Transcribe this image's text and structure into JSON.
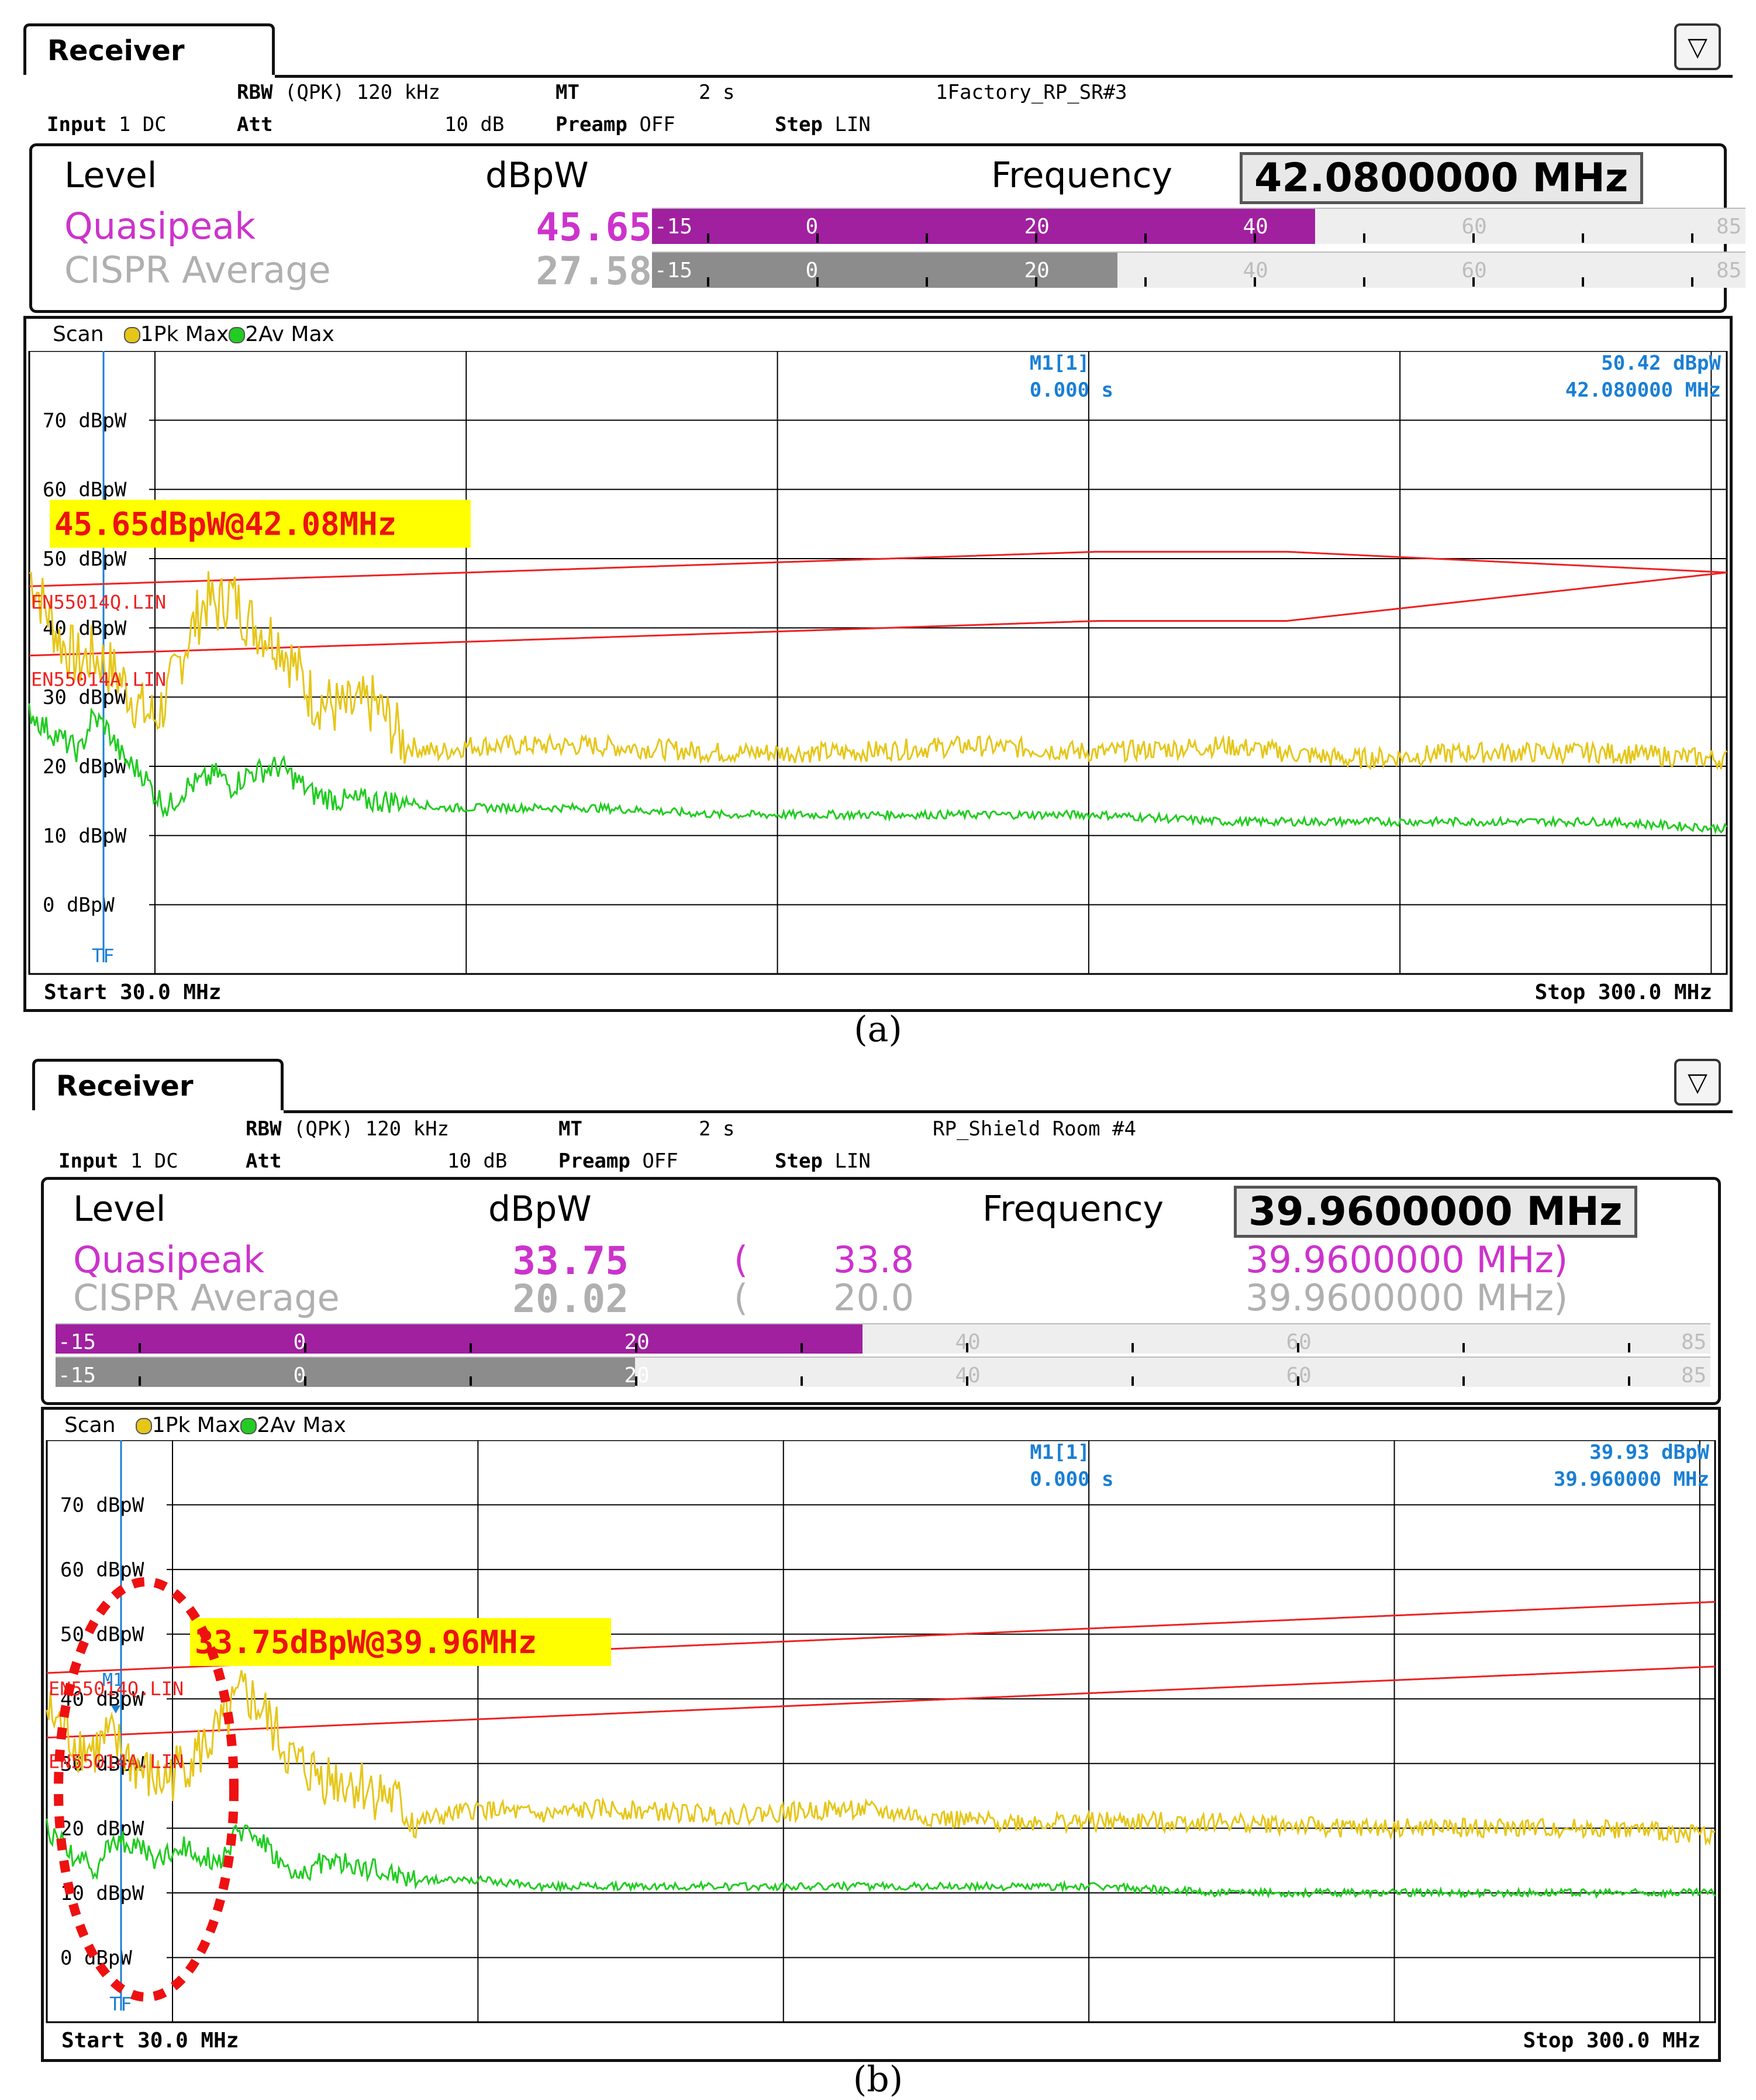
{
  "panels": [
    {
      "caption": "(a)",
      "tab": "Receiver",
      "settings": {
        "rbw_label": "RBW",
        "rbw_value": "(QPK) 120 kHz",
        "mt_label": "MT",
        "mt_value": "2 s",
        "setup_name": "1Factory_RP_SR#3",
        "input_label": "Input",
        "input_value": "1 DC",
        "att_label": "Att",
        "att_value": "10 dB",
        "preamp_label": "Preamp",
        "preamp_value": "OFF",
        "step_label": "Step",
        "step_value": "LIN"
      },
      "level": {
        "level_label": "Level",
        "unit": "dBpW",
        "frequency_label": "Frequency",
        "frequency": "42.0800000 MHz",
        "detectors": [
          {
            "name": "Quasipeak",
            "value": "45.65",
            "level": 45.65,
            "color": "#cc33cc"
          },
          {
            "name": "CISPR Average",
            "value": "27.58",
            "level": 27.58,
            "color": "#b0b0b0"
          }
        ],
        "bar_ticks": [
          "-15",
          "0",
          "20",
          "40",
          "60",
          "85"
        ]
      },
      "scan_label": "Scan",
      "legend": [
        "1Pk Max",
        "2Av Max"
      ],
      "marker": {
        "name": "M1[1]",
        "time": "0.000 s",
        "level": "50.42 dBpW",
        "freq": "42.080000 MHz"
      },
      "annotation": "45.65dBpW@42.08MHz",
      "limit_q_label": "EN55014Q.LIN",
      "limit_a_label": "EN55014A.LIN",
      "tf_label": "TF",
      "start": "Start 30.0 MHz",
      "stop": "Stop 300.0 MHz",
      "y_ticks": [
        "70 dBpW",
        "60 dBpW",
        "50 dBpW",
        "40 dBpW",
        "30 dBpW",
        "20 dBpW",
        "10 dBpW",
        "0 dBpW"
      ]
    },
    {
      "caption": "(b)",
      "tab": "Receiver",
      "settings": {
        "rbw_label": "RBW",
        "rbw_value": "(QPK) 120 kHz",
        "mt_label": "MT",
        "mt_value": "2 s",
        "setup_name": "RP_Shield Room #4",
        "input_label": "Input",
        "input_value": "1 DC",
        "att_label": "Att",
        "att_value": "10 dB",
        "preamp_label": "Preamp",
        "preamp_value": "OFF",
        "step_label": "Step",
        "step_value": "LIN"
      },
      "level": {
        "level_label": "Level",
        "unit": "dBpW",
        "frequency_label": "Frequency",
        "frequency": "39.9600000 MHz",
        "detectors": [
          {
            "name": "Quasipeak",
            "value": "33.75",
            "paren_value": "33.8",
            "paren_freq": "39.9600000 MHz)",
            "level": 33.75,
            "color": "#cc33cc"
          },
          {
            "name": "CISPR Average",
            "value": "20.02",
            "paren_value": "20.0",
            "paren_freq": "39.9600000 MHz)",
            "level": 20.02,
            "color": "#b0b0b0"
          }
        ],
        "paren_open": "(",
        "bar_ticks": [
          "-15",
          "0",
          "20",
          "40",
          "60",
          "85"
        ]
      },
      "scan_label": "Scan",
      "legend": [
        "1Pk Max",
        "2Av Max"
      ],
      "marker": {
        "name": "M1[1]",
        "time": "0.000 s",
        "level": "39.93 dBpW",
        "freq": "39.960000 MHz",
        "flag": "M1"
      },
      "annotation": "33.75dBpW@39.96MHz",
      "limit_q_label": "EN55014Q.LIN",
      "limit_a_label": "EN55014A.LIN",
      "tf_label": "TF",
      "start": "Start 30.0 MHz",
      "stop": "Stop 300.0 MHz",
      "y_ticks": [
        "70 dBpW",
        "60 dBpW",
        "50 dBpW",
        "40 dBpW",
        "30 dBpW",
        "20 dBpW",
        "10 dBpW",
        "0 dBpW"
      ]
    }
  ],
  "colors": {
    "peak_trace": "#e6c619",
    "avg_trace": "#22cc22",
    "limit": "#ee2222",
    "marker_text": "#1a7fd4",
    "annotation_bg": "#ffff00",
    "annotation_text": "#ee1111",
    "highlight_circle": "#ee1111"
  },
  "chart_data": [
    {
      "type": "line",
      "xlim": [
        30,
        300
      ],
      "ylim": [
        -10,
        80
      ],
      "xlabel": "",
      "ylabel": "",
      "grid": true,
      "series": [
        {
          "name": "1Pk Max",
          "x": [
            30,
            32,
            35,
            38,
            40,
            42,
            45,
            48,
            50,
            52,
            55,
            58,
            60,
            62,
            65,
            70,
            75,
            80,
            85,
            90,
            95,
            100,
            110,
            120,
            140,
            160,
            180,
            200,
            220,
            240,
            260,
            280,
            300
          ],
          "y": [
            48,
            44,
            38,
            35,
            36,
            35,
            32,
            28,
            27,
            30,
            38,
            44,
            43,
            45,
            41,
            38,
            30,
            28,
            29,
            23,
            22,
            23,
            23,
            23,
            22,
            22,
            23,
            22,
            23,
            21,
            22,
            22,
            21
          ]
        },
        {
          "name": "2Av Max",
          "x": [
            30,
            32,
            35,
            38,
            40,
            42,
            45,
            48,
            50,
            52,
            55,
            58,
            60,
            62,
            65,
            70,
            75,
            80,
            85,
            90,
            95,
            100,
            110,
            120,
            140,
            160,
            180,
            200,
            220,
            240,
            260,
            280,
            300
          ],
          "y": [
            28,
            26,
            24,
            22,
            27,
            26,
            21,
            19,
            16,
            14,
            17,
            18,
            19,
            17,
            19,
            20,
            16,
            15,
            15,
            15,
            14,
            14,
            14,
            14,
            13,
            13,
            13,
            13,
            12,
            12,
            12,
            12,
            11
          ]
        },
        {
          "name": "EN55014Q.LIN",
          "x": [
            30,
            100,
            200,
            230,
            300
          ],
          "y": [
            46,
            48,
            51,
            51,
            48
          ]
        },
        {
          "name": "EN55014A.LIN",
          "x": [
            30,
            100,
            200,
            230,
            300
          ],
          "y": [
            36,
            38,
            41,
            41,
            48
          ]
        }
      ]
    },
    {
      "type": "line",
      "xlim": [
        30,
        300
      ],
      "ylim": [
        -10,
        80
      ],
      "xlabel": "",
      "ylabel": "",
      "grid": true,
      "series": [
        {
          "name": "1Pk Max",
          "x": [
            30,
            32,
            35,
            38,
            40,
            42,
            45,
            48,
            50,
            52,
            55,
            58,
            60,
            62,
            65,
            70,
            75,
            80,
            85,
            90,
            95,
            100,
            110,
            120,
            140,
            160,
            180,
            200,
            220,
            240,
            260,
            280,
            300
          ],
          "y": [
            38,
            36,
            33,
            32,
            34,
            32,
            29,
            27,
            28,
            30,
            32,
            35,
            38,
            41,
            38,
            30,
            28,
            27,
            25,
            21,
            22,
            23,
            22,
            23,
            22,
            23,
            21,
            21,
            21,
            20,
            20,
            20,
            19
          ]
        },
        {
          "name": "2Av Max",
          "x": [
            30,
            32,
            35,
            38,
            40,
            42,
            45,
            48,
            50,
            52,
            55,
            58,
            60,
            62,
            65,
            70,
            75,
            80,
            85,
            90,
            95,
            100,
            110,
            120,
            140,
            160,
            180,
            200,
            220,
            240,
            260,
            280,
            300
          ],
          "y": [
            20,
            18,
            15,
            14,
            17,
            18,
            17,
            15,
            16,
            17,
            16,
            15,
            18,
            20,
            18,
            12,
            15,
            14,
            13,
            12,
            12,
            12,
            11,
            11,
            11,
            11,
            11,
            11,
            10,
            10,
            10,
            10,
            10
          ]
        },
        {
          "name": "EN55014Q.LIN",
          "x": [
            30,
            300
          ],
          "y": [
            44,
            55
          ]
        },
        {
          "name": "EN55014A.LIN",
          "x": [
            30,
            300
          ],
          "y": [
            34,
            45
          ]
        }
      ]
    }
  ]
}
